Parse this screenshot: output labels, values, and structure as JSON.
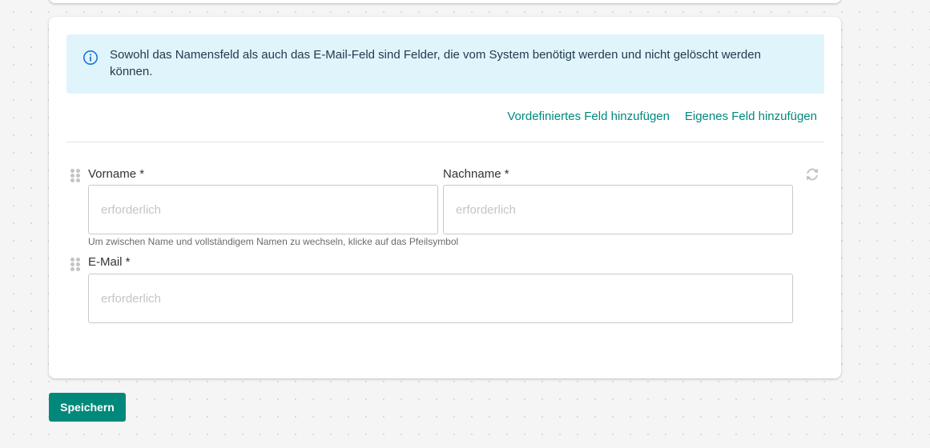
{
  "info": {
    "icon": "info-circle-icon",
    "text": "Sowohl das Namensfeld als auch das E-Mail-Feld sind Felder, die vom System benötigt werden und nicht gelöscht werden können."
  },
  "actions": {
    "predefined_field": "Vordefiniertes Feld hinzufügen",
    "custom_field": "Eigenes Feld hinzufügen"
  },
  "fields": {
    "first_name": {
      "label": "Vorname *",
      "placeholder": "erforderlich",
      "value": ""
    },
    "last_name": {
      "label": "Nachname *",
      "placeholder": "erforderlich",
      "value": ""
    },
    "name_hint": "Um zwischen Name und vollständigem Namen zu wechseln, klicke auf das Pfeilsymbol",
    "email": {
      "label": "E-Mail *",
      "placeholder": "erforderlich",
      "value": ""
    }
  },
  "icons": {
    "drag": "drag-handle-icon",
    "toggle": "refresh-arrows-icon"
  },
  "save_label": "Speichern",
  "colors": {
    "accent": "#00897b",
    "info_bg": "#e0f4fb",
    "info_icon": "#1976d2"
  }
}
